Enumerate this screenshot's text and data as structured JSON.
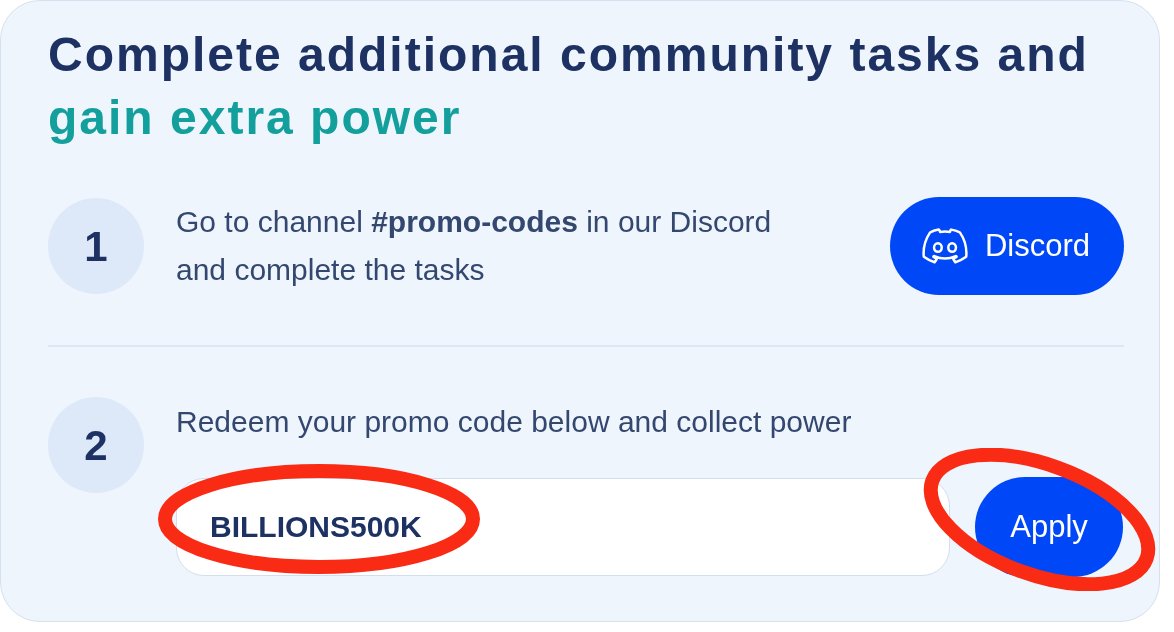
{
  "heading": {
    "text": "Complete additional community tasks and",
    "highlight": "gain extra power"
  },
  "steps": [
    {
      "number": "1",
      "kind": "link",
      "text": "Go to channel **#promo-codes** in our Discord and complete the tasks",
      "button": {
        "label": "Discord"
      }
    },
    {
      "number": "2",
      "kind": "code",
      "text": "Redeem your promo code below and collect power",
      "code_field": {
        "value": "BILLIONS500K",
        "circled": true
      },
      "button": {
        "label": "Apply",
        "circled": true
      }
    }
  ]
}
